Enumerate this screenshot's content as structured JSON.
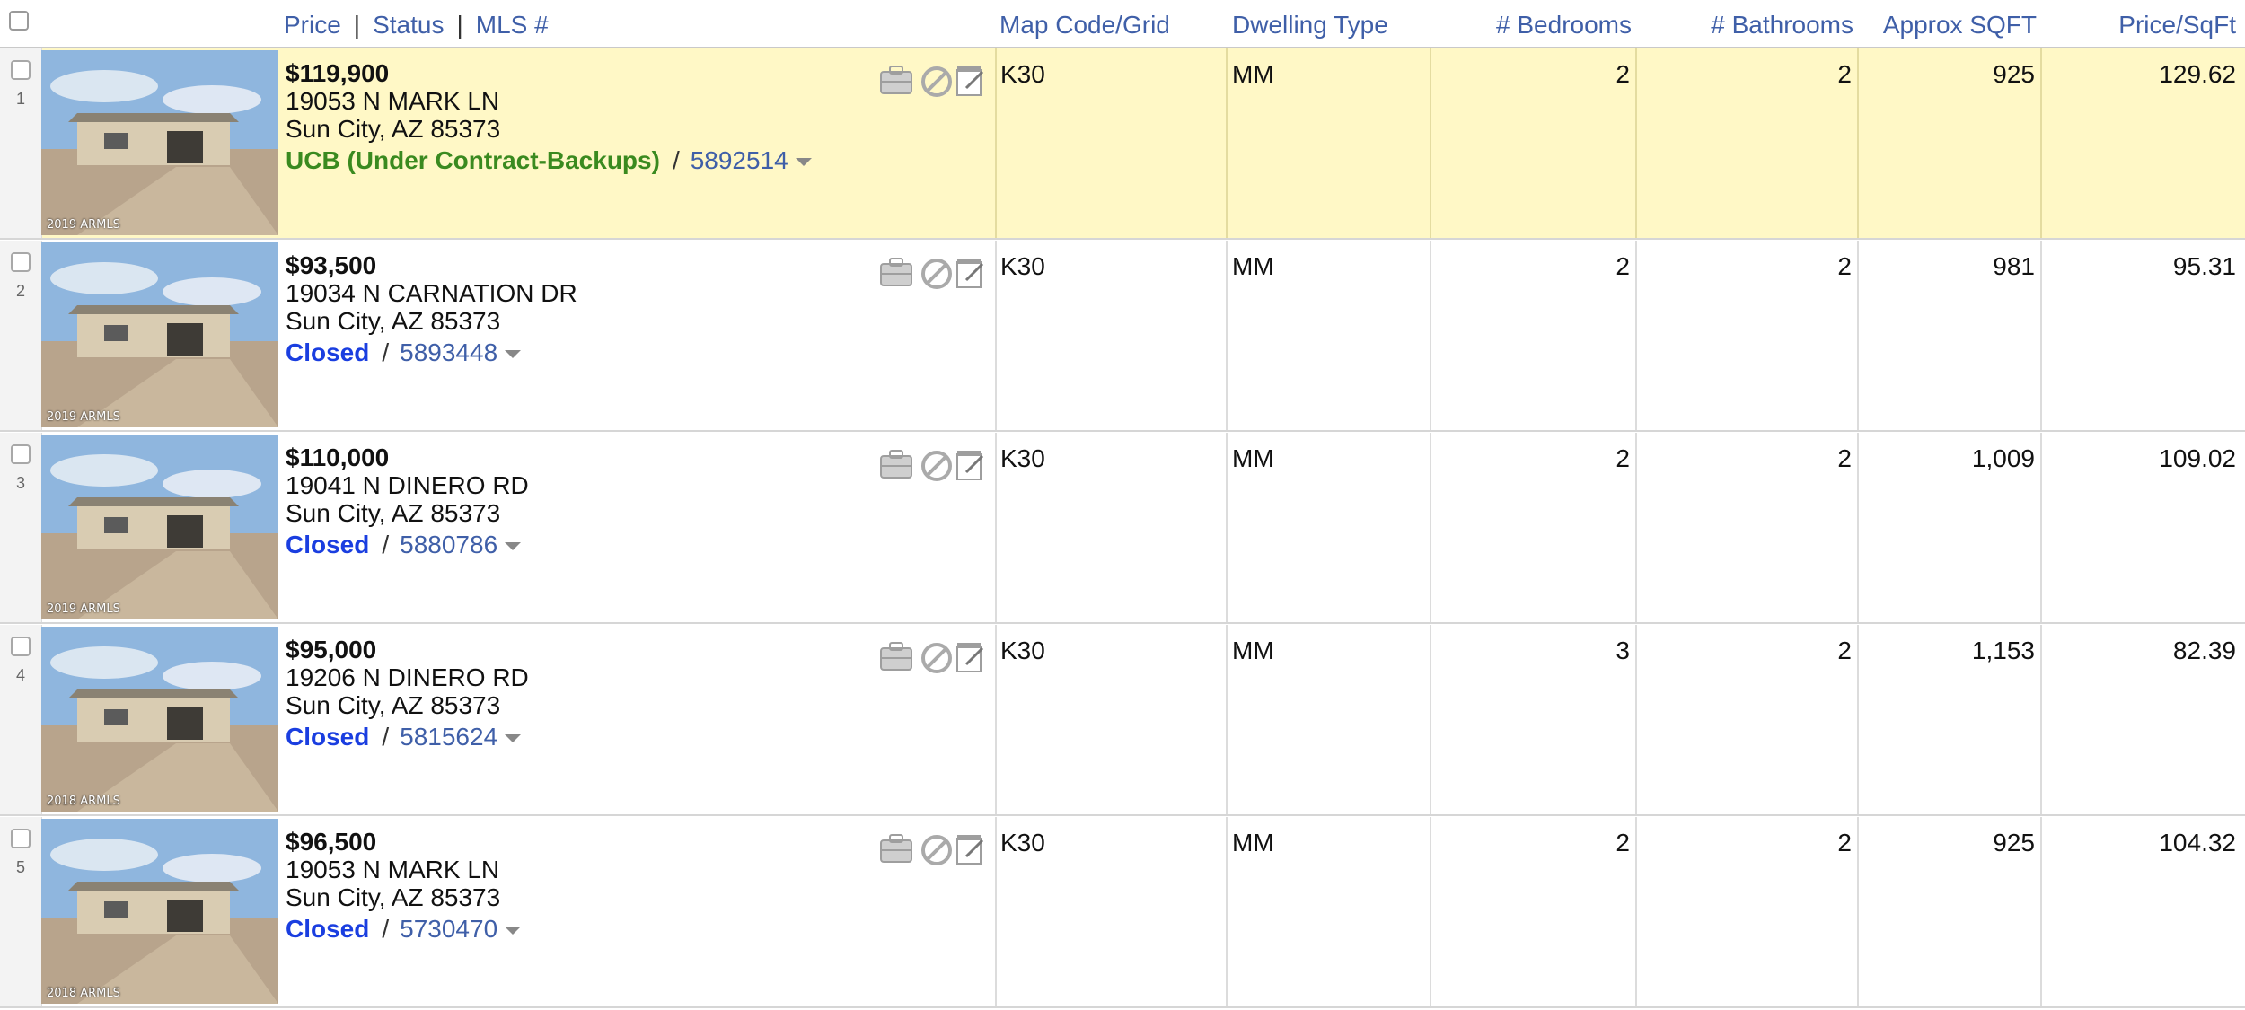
{
  "header": {
    "price_label": "Price",
    "status_label": "Status",
    "mls_label": "MLS #",
    "separator": "|",
    "map_code": "Map Code/Grid",
    "dwelling_type": "Dwelling Type",
    "bedrooms": "# Bedrooms",
    "bathrooms": "# Bathrooms",
    "sqft": "Approx SQFT",
    "price_sqft": "Price/SqFt"
  },
  "colors": {
    "highlight_row": "#fff8c6",
    "link_blue": "#3f5fa8",
    "status_ucb": "#3a8a1f",
    "status_closed": "#1a3ee0"
  },
  "listings": [
    {
      "row_num": "1",
      "price": "$119,900",
      "address": "19053 N MARK LN",
      "city": "Sun City, AZ 85373",
      "status": "UCB (Under Contract-Backups)",
      "mls": "5892514",
      "map_code": "K30",
      "dwelling": "MM",
      "beds": "2",
      "baths": "2",
      "sqft": "925",
      "price_sqft": "129.62",
      "watermark": "2019 ARMLS",
      "highlighted": true
    },
    {
      "row_num": "2",
      "price": "$93,500",
      "address": "19034 N CARNATION DR",
      "city": "Sun City, AZ 85373",
      "status": "Closed",
      "mls": "5893448",
      "map_code": "K30",
      "dwelling": "MM",
      "beds": "2",
      "baths": "2",
      "sqft": "981",
      "price_sqft": "95.31",
      "watermark": "2019 ARMLS",
      "highlighted": false
    },
    {
      "row_num": "3",
      "price": "$110,000",
      "address": "19041 N DINERO RD",
      "city": "Sun City, AZ 85373",
      "status": "Closed",
      "mls": "5880786",
      "map_code": "K30",
      "dwelling": "MM",
      "beds": "2",
      "baths": "2",
      "sqft": "1,009",
      "price_sqft": "109.02",
      "watermark": "2019 ARMLS",
      "highlighted": false
    },
    {
      "row_num": "4",
      "price": "$95,000",
      "address": "19206 N DINERO RD",
      "city": "Sun City, AZ 85373",
      "status": "Closed",
      "mls": "5815624",
      "map_code": "K30",
      "dwelling": "MM",
      "beds": "3",
      "baths": "2",
      "sqft": "1,153",
      "price_sqft": "82.39",
      "watermark": "2018 ARMLS",
      "highlighted": false
    },
    {
      "row_num": "5",
      "price": "$96,500",
      "address": "19053 N MARK LN",
      "city": "Sun City, AZ 85373",
      "status": "Closed",
      "mls": "5730470",
      "map_code": "K30",
      "dwelling": "MM",
      "beds": "2",
      "baths": "2",
      "sqft": "925",
      "price_sqft": "104.32",
      "watermark": "2018 ARMLS",
      "highlighted": false
    }
  ],
  "icons": [
    "briefcase-icon",
    "prohibited-icon",
    "edit-note-icon",
    "chevron-down-icon",
    "checkbox-icon"
  ]
}
